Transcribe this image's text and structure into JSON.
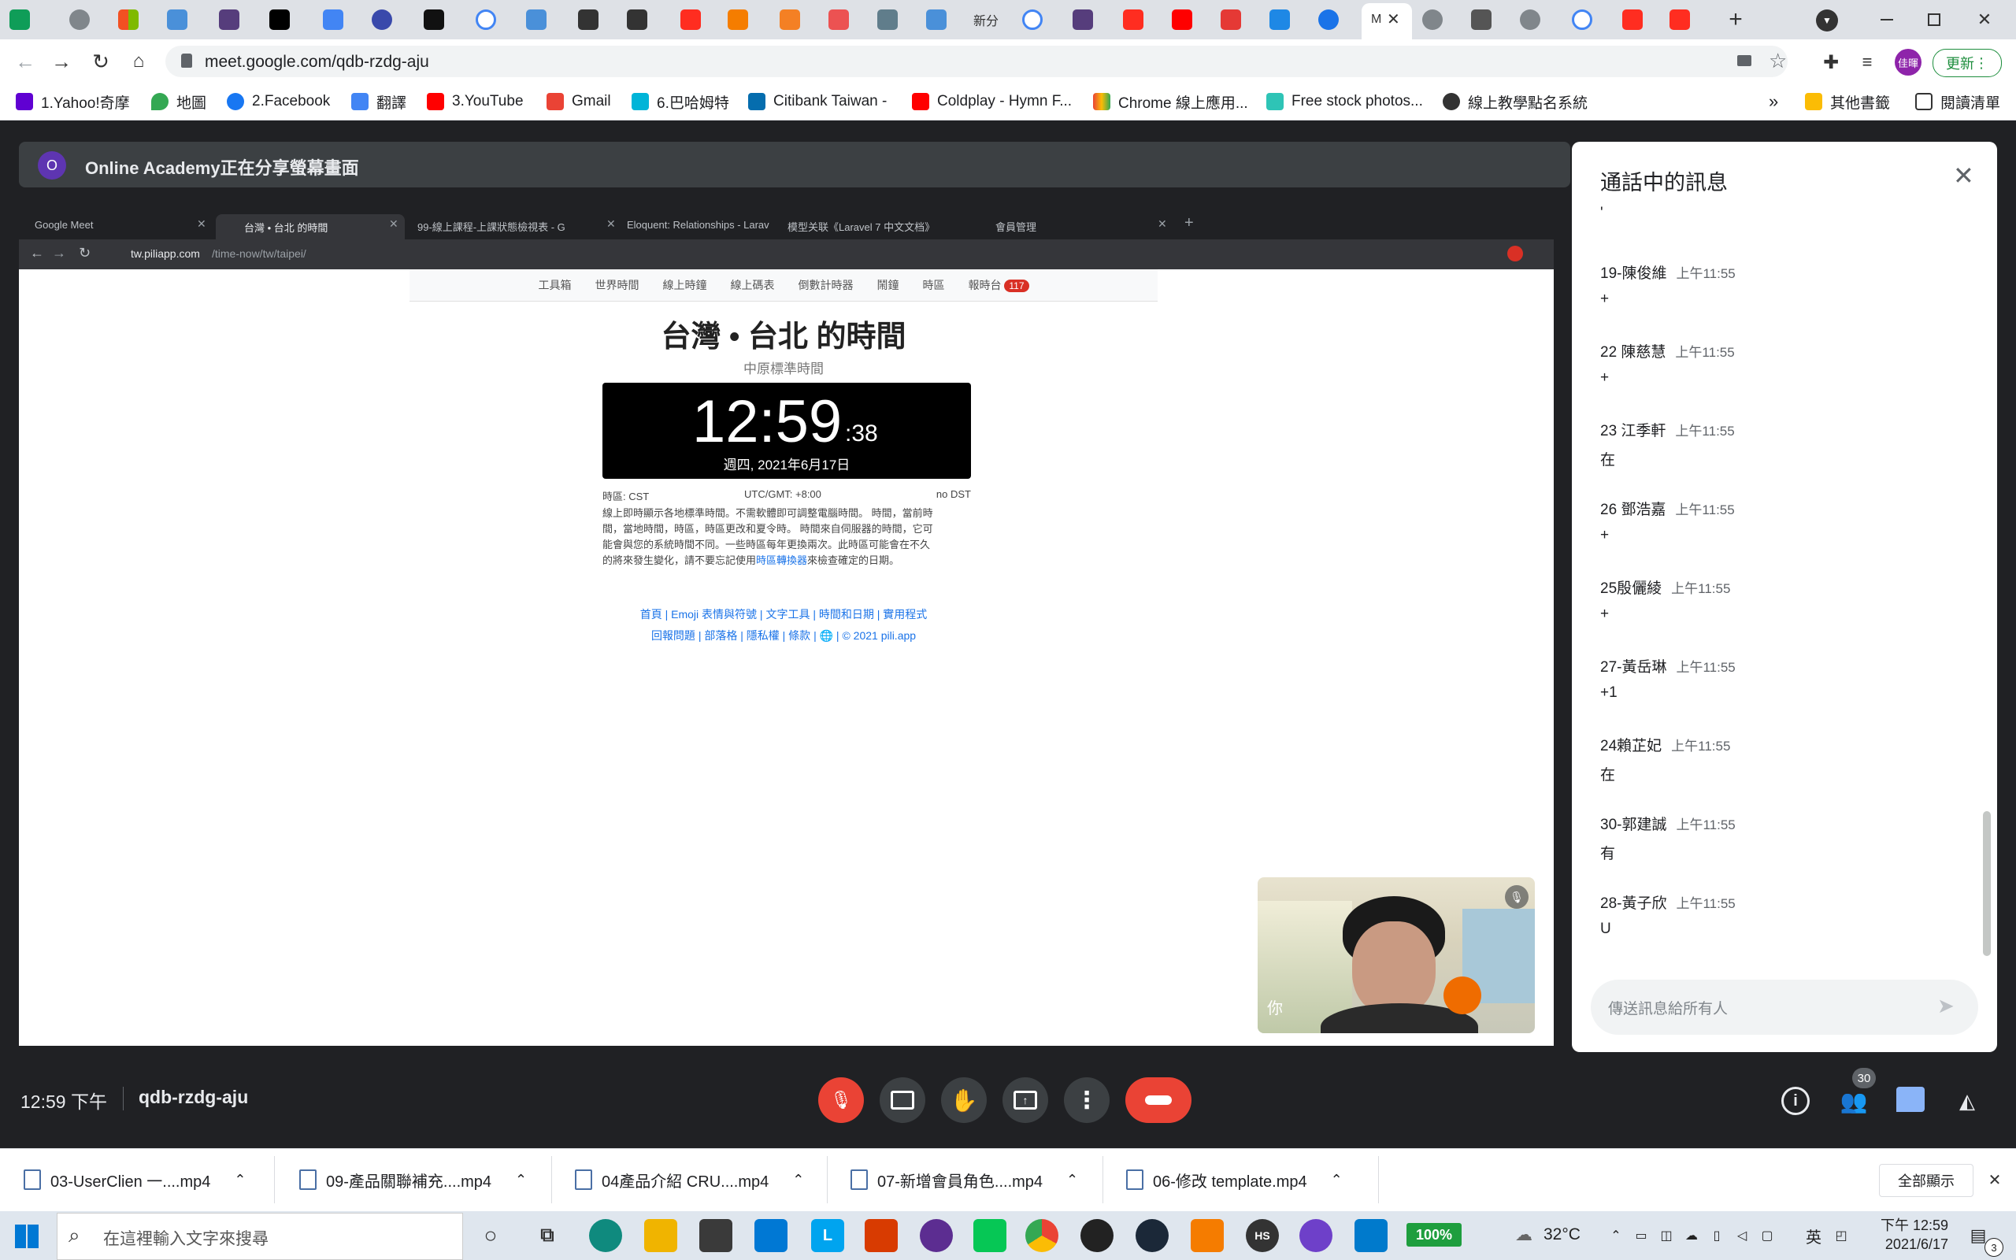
{
  "browser": {
    "new_tab": "+",
    "close_tab": "✕",
    "address": "meet.google.com/qdb-rzdg-aju",
    "update_button": "更新",
    "profile_initials": "佳暉",
    "tab_fragments": [
      "新分"
    ],
    "bookmarks": [
      "1.Yahoo!奇摩",
      "地圖",
      "2.Facebook",
      "翻譯",
      "3.YouTube",
      "Gmail",
      "6.巴哈姆特",
      "Citibank Taiwan -",
      "Coldplay - Hymn F...",
      "Chrome 線上應用...",
      "Free stock photos...",
      "線上教學點名系統"
    ],
    "more_bookmarks": "»",
    "other_bookmarks": "其他書籤",
    "reading_list": "閱讀清單"
  },
  "meet": {
    "presenter_initial": "O",
    "presenter_banner": "Online Academy正在分享螢幕畫面",
    "time": "12:59 下午",
    "meeting_code": "qdb-rzdg-aju",
    "participant_count": "30",
    "self_label": "你",
    "chat": {
      "title": "通話中的訊息",
      "top_fragment": "'",
      "messages": [
        {
          "name": "19-陳俊維",
          "time": "上午11:55",
          "text": "+"
        },
        {
          "name": "22 陳慈慧",
          "time": "上午11:55",
          "text": "+"
        },
        {
          "name": "23 江季軒",
          "time": "上午11:55",
          "text": "在"
        },
        {
          "name": "26 鄧浩嘉",
          "time": "上午11:55",
          "text": "+"
        },
        {
          "name": "25殷儷綾",
          "time": "上午11:55",
          "text": "+"
        },
        {
          "name": "27-黃岳琳",
          "time": "上午11:55",
          "text": "+1"
        },
        {
          "name": "24賴芷妃",
          "time": "上午11:55",
          "text": "在"
        },
        {
          "name": "30-郭建誠",
          "time": "上午11:55",
          "text": "有"
        },
        {
          "name": "28-黃子欣",
          "time": "上午11:55",
          "text": "U"
        }
      ],
      "input_placeholder": "傳送訊息給所有人"
    }
  },
  "shared_screen": {
    "tabs": [
      "Google Meet",
      "台灣 • 台北 的時間",
      "99-線上課程-上課狀態檢視表 - G",
      "Eloquent: Relationships - Larav",
      "模型关联《Laravel 7 中文文档》",
      "會員管理"
    ],
    "url_host": "tw.piliapp.com",
    "url_path": "/time-now/tw/taipei/",
    "nav": [
      "工具箱",
      "世界時間",
      "線上時鐘",
      "線上碼表",
      "倒數計時器",
      "鬧鐘",
      "時區",
      "報時台"
    ],
    "nav_badge": "117",
    "heading": "台灣 • 台北 的時間",
    "subheading": "中原標準時間",
    "clock_main": "12:59",
    "clock_sec": ":38",
    "clock_date": "週四, 2021年6月17日",
    "tz_left": "時區: CST",
    "tz_mid": "UTC/GMT: +8:00",
    "tz_right": "no DST",
    "desc_1": "線上即時顯示各地標準時間。不需軟體即可調整電腦時間。 時間，當前時",
    "desc_2": "間，當地時間，時區，時區更改和夏令時。 時間來自伺服器的時間，它可",
    "desc_3": "能會與您的系統時間不同。一些時區每年更換兩次。此時區可能會在不久",
    "desc_4_a": "的將來發生變化，請不要忘記使用",
    "desc_4_link": "時區轉換器",
    "desc_4_b": "來檢查確定的日期。",
    "footer_1": "首頁 | Emoji 表情與符號 | 文字工具 | 時間和日期 | 實用程式",
    "footer_2": "回報問題 | 部落格 | 隱私權 | 條款 | 🌐 | © 2021 pili.app"
  },
  "downloads": {
    "items": [
      "03-UserClien 一....mp4",
      "09-產品關聯補充....mp4",
      "04產品介紹 CRU....mp4",
      "07-新增會員角色....mp4",
      "06-修改 template.mp4"
    ],
    "show_all": "全部顯示",
    "close": "✕"
  },
  "taskbar": {
    "search_placeholder": "在這裡輸入文字來搜尋",
    "battery": "100%",
    "temperature": "32°C",
    "ime": "英",
    "clock_time": "下午 12:59",
    "clock_date": "2021/6/17",
    "notification_count": "3"
  }
}
